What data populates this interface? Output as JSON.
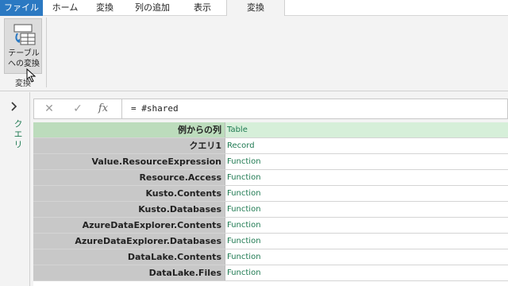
{
  "ribbon_tabs": [
    "ファイル",
    "ホーム",
    "変換",
    "列の追加",
    "表示"
  ],
  "context_tab": "変換",
  "ribbon": {
    "convert_button": {
      "line1": "テーブル",
      "line2": "への変換",
      "icon": "table-convert-icon"
    },
    "group_label": "変換"
  },
  "query_pane": {
    "label": "クエリ",
    "collapse_icon": "chevron-right-icon"
  },
  "formula_bar": {
    "cancel_icon": "close-icon",
    "commit_icon": "checkmark-icon",
    "fx_label": "fx",
    "formula": "= #shared"
  },
  "rows": [
    {
      "name": "例からの列",
      "value": "Table"
    },
    {
      "name": "クエリ1",
      "value": "Record"
    },
    {
      "name": "Value.ResourceExpression",
      "value": "Function"
    },
    {
      "name": "Resource.Access",
      "value": "Function"
    },
    {
      "name": "Kusto.Contents",
      "value": "Function"
    },
    {
      "name": "Kusto.Databases",
      "value": "Function"
    },
    {
      "name": "AzureDataExplorer.Contents",
      "value": "Function"
    },
    {
      "name": "AzureDataExplorer.Databases",
      "value": "Function"
    },
    {
      "name": "DataLake.Contents",
      "value": "Function"
    },
    {
      "name": "DataLake.Files",
      "value": "Function"
    }
  ],
  "colors": {
    "file_tab": "#2b79c2",
    "selected_row": "#d6efd9",
    "value_text": "#1f7a52"
  }
}
